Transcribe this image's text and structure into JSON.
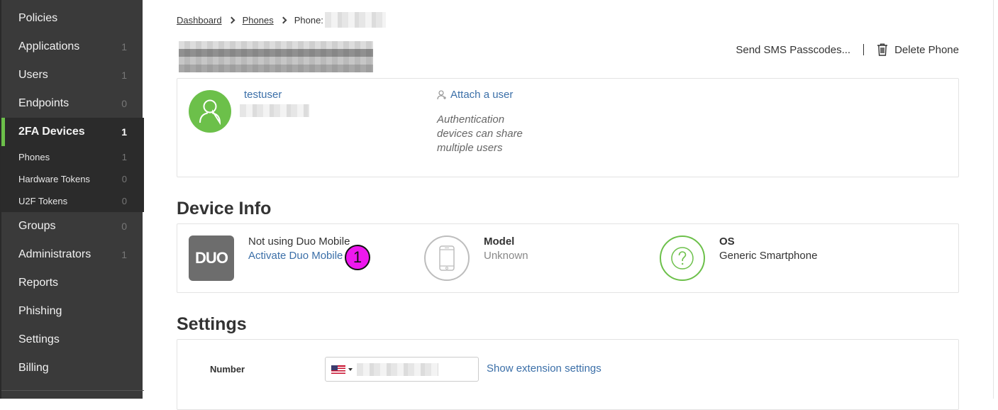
{
  "sidebar": {
    "items": [
      {
        "label": "Policies",
        "count": ""
      },
      {
        "label": "Applications",
        "count": "1"
      },
      {
        "label": "Users",
        "count": "1"
      },
      {
        "label": "Endpoints",
        "count": "0"
      },
      {
        "label": "2FA Devices",
        "count": "1"
      },
      {
        "label": "Groups",
        "count": "0"
      },
      {
        "label": "Administrators",
        "count": "1"
      },
      {
        "label": "Reports",
        "count": ""
      },
      {
        "label": "Phishing",
        "count": ""
      },
      {
        "label": "Settings",
        "count": ""
      },
      {
        "label": "Billing",
        "count": ""
      }
    ],
    "sub_items": [
      {
        "label": "Phones",
        "count": "1"
      },
      {
        "label": "Hardware Tokens",
        "count": "0"
      },
      {
        "label": "U2F Tokens",
        "count": "0"
      }
    ]
  },
  "breadcrumb": {
    "dashboard": "Dashboard",
    "phones": "Phones",
    "current_prefix": "Phone:"
  },
  "header_actions": {
    "send_sms": "Send SMS Passcodes...",
    "delete_phone": "Delete Phone"
  },
  "user_card": {
    "username": "testuser",
    "attach_link": "Attach a user",
    "attach_note": "Authentication devices can share multiple users"
  },
  "device_info": {
    "title": "Device Info",
    "duo_logo_text": "DUO",
    "duo_status": "Not using Duo Mobile",
    "activate_link": "Activate Duo Mobile",
    "marker_number": "1",
    "model_label": "Model",
    "model_value": "Unknown",
    "os_label": "OS",
    "os_value": "Generic Smartphone"
  },
  "settings": {
    "title": "Settings",
    "number_label": "Number",
    "extension_link": "Show extension settings"
  },
  "colors": {
    "accent_green": "#6cc04a",
    "link_blue": "#3b6fa8",
    "sidebar_bg": "#3a3a3a",
    "marker_magenta": "#ee18ee"
  }
}
